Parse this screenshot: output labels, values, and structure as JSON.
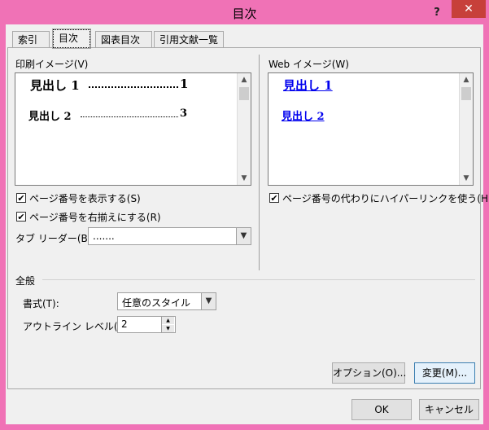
{
  "window": {
    "title": "目次",
    "help_glyph": "?",
    "close_glyph": "✕"
  },
  "tabs": [
    {
      "label": "索引"
    },
    {
      "label": "目次"
    },
    {
      "label": "図表目次"
    },
    {
      "label": "引用文献一覧"
    }
  ],
  "print_preview": {
    "label": "印刷イメージ(V)",
    "entry1_text": "見出し 1",
    "entry1_page": "1",
    "entry2_text": "見出し 2",
    "entry2_page": "3"
  },
  "web_preview": {
    "label": "Web イメージ(W)",
    "entry1_text": "見出し 1",
    "entry2_text": "見出し 2"
  },
  "options": {
    "show_page_numbers": {
      "label": "ページ番号を表示する(S)",
      "checked": true
    },
    "right_align": {
      "label": "ページ番号を右揃えにする(R)",
      "checked": true
    },
    "use_hyperlinks": {
      "label": "ページ番号の代わりにハイパーリンクを使う(H)",
      "checked": true
    },
    "tab_leader": {
      "label": "タブ リーダー(B):",
      "value": "......."
    }
  },
  "general": {
    "section_label": "全般",
    "format": {
      "label": "書式(T):",
      "value": "任意のスタイル"
    },
    "outline_level": {
      "label": "アウトライン レベル(L):",
      "value": "2"
    }
  },
  "buttons": {
    "options": "オプション(O)...",
    "modify": "変更(M)...",
    "ok": "OK",
    "cancel": "キャンセル"
  },
  "check_glyph": "✔",
  "arrow_down_glyph": "▼",
  "arrow_up_glyph": "▲"
}
